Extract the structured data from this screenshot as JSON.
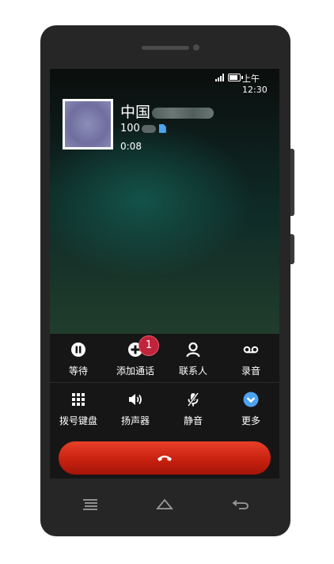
{
  "status_bar": {
    "time": "上午12:30",
    "signal_icon": "signal-icon",
    "battery_icon": "battery-icon"
  },
  "caller": {
    "name_visible": "中国",
    "number_visible": "100",
    "duration": "0:08"
  },
  "controls": {
    "row1": [
      {
        "label": "等待",
        "icon": "pause-icon"
      },
      {
        "label": "添加通话",
        "icon": "add-call-icon"
      },
      {
        "label": "联系人",
        "icon": "contacts-icon"
      },
      {
        "label": "录音",
        "icon": "record-icon"
      }
    ],
    "row2": [
      {
        "label": "拨号键盘",
        "icon": "dialpad-icon"
      },
      {
        "label": "扬声器",
        "icon": "speaker-icon"
      },
      {
        "label": "静音",
        "icon": "mute-icon"
      },
      {
        "label": "更多",
        "icon": "more-icon"
      }
    ],
    "badge": "1"
  },
  "end_call": {
    "icon": "end-call-icon"
  },
  "nav": {
    "menu_icon": "menu-icon",
    "home_icon": "home-icon",
    "back_icon": "back-icon"
  },
  "colors": {
    "end_call": "#d22a15",
    "badge": "#c0233a",
    "accent_blue": "#4da3f0"
  }
}
